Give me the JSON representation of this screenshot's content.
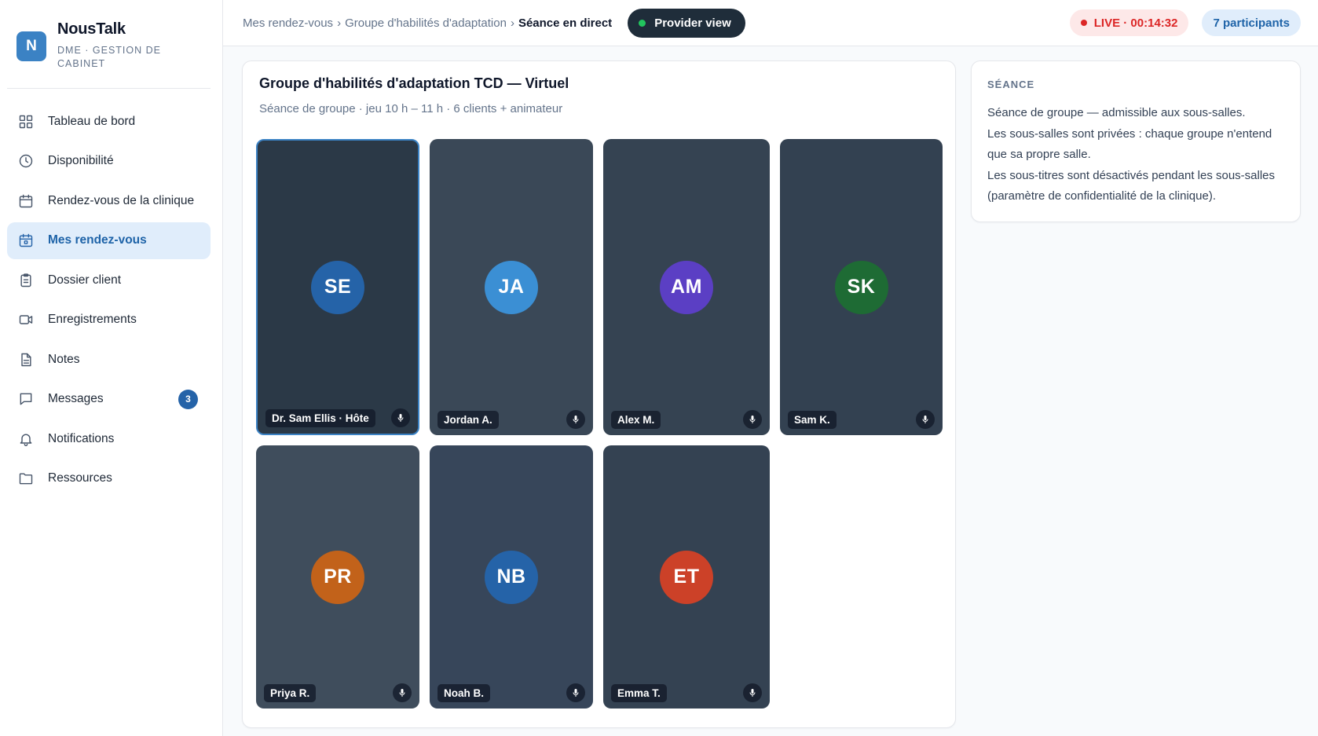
{
  "brand": {
    "logo_letter": "N",
    "name": "NousTalk",
    "subtitle": "DME · GESTION DE CABINET"
  },
  "sidebar": {
    "items": [
      {
        "label": "Tableau de bord",
        "icon": "grid-icon"
      },
      {
        "label": "Disponibilité",
        "icon": "clock-icon"
      },
      {
        "label": "Rendez-vous de la clinique",
        "icon": "calendar-icon"
      },
      {
        "label": "Mes rendez-vous",
        "icon": "calendar-check-icon",
        "active": true
      },
      {
        "label": "Dossier client",
        "icon": "clipboard-icon"
      },
      {
        "label": "Enregistrements",
        "icon": "video-icon"
      },
      {
        "label": "Notes",
        "icon": "document-icon"
      },
      {
        "label": "Messages",
        "icon": "message-icon",
        "badge": "3"
      },
      {
        "label": "Notifications",
        "icon": "bell-icon"
      },
      {
        "label": "Ressources",
        "icon": "folder-icon"
      }
    ]
  },
  "topbar": {
    "breadcrumb": [
      "Mes rendez-vous",
      "Groupe d'habilités d'adaptation",
      "Séance en direct"
    ],
    "separator": "›",
    "provider_button": "Provider view",
    "live": "LIVE · 00:14:32",
    "participants": "7 participants"
  },
  "session": {
    "title": "Groupe d'habilités d'adaptation TCD — Virtuel",
    "subtitle": "Séance de groupe · jeu 10 h – 11 h · 6 clients + animateur"
  },
  "participants": [
    {
      "initials": "SE",
      "name": "Dr. Sam Ellis · Hôte",
      "color": "#2563a8",
      "host": true
    },
    {
      "initials": "JA",
      "name": "Jordan A.",
      "color": "#3b8fd4"
    },
    {
      "initials": "AM",
      "name": "Alex M.",
      "color": "#5b3fc4"
    },
    {
      "initials": "SK",
      "name": "Sam K.",
      "color": "#1e6b34"
    },
    {
      "initials": "PR",
      "name": "Priya R.",
      "color": "#c2621a"
    },
    {
      "initials": "NB",
      "name": "Noah B.",
      "color": "#2563a8"
    },
    {
      "initials": "ET",
      "name": "Emma T.",
      "color": "#cc4128"
    }
  ],
  "session_card": {
    "title": "SÉANCE",
    "lines": [
      "Séance de groupe — admissible aux sous-salles.",
      "Les sous-salles sont privées : chaque groupe n'entend que sa propre salle.",
      "Les sous-titres sont désactivés pendant les sous-salles (paramètre de confidentialité de la clinique)."
    ]
  }
}
